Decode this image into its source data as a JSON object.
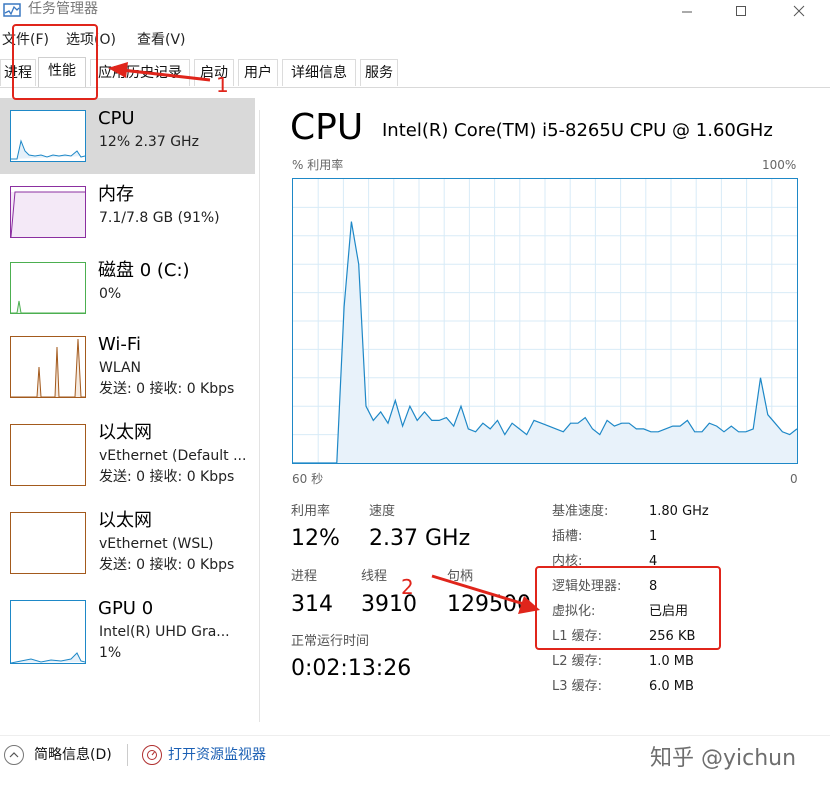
{
  "window": {
    "title": "任务管理器"
  },
  "menu": [
    "文件(F)",
    "选项(O)",
    "查看(V)"
  ],
  "tabs": [
    "进程",
    "性能",
    "应用历史记录",
    "启动",
    "用户",
    "详细信息",
    "服务"
  ],
  "sidebar": {
    "items": [
      {
        "title": "CPU",
        "line1": "12% 2.37 GHz",
        "line2": "",
        "color": "#1e88c7",
        "active": true
      },
      {
        "title": "内存",
        "line1": "7.1/7.8 GB (91%)",
        "line2": "",
        "color": "#8b2fa0",
        "active": false
      },
      {
        "title": "磁盘 0 (C:)",
        "line1": "0%",
        "line2": "",
        "color": "#4caf50",
        "active": false
      },
      {
        "title": "Wi-Fi",
        "line1": "WLAN",
        "line2": "发送: 0 接收: 0 Kbps",
        "color": "#a35a1d",
        "active": false
      },
      {
        "title": "以太网",
        "line1": "vEthernet (Default ...",
        "line2": "发送: 0 接收: 0 Kbps",
        "color": "#a35a1d",
        "active": false
      },
      {
        "title": "以太网",
        "line1": "vEthernet (WSL)",
        "line2": "发送: 0 接收: 0 Kbps",
        "color": "#a35a1d",
        "active": false
      },
      {
        "title": "GPU 0",
        "line1": "Intel(R) UHD Gra...",
        "line2": "1%",
        "color": "#1e88c7",
        "active": false
      }
    ]
  },
  "main": {
    "title": "CPU",
    "model": "Intel(R) Core(TM) i5-8265U CPU @ 1.60GHz",
    "graph": {
      "ylabel": "% 利用率",
      "ymax_label": "100%",
      "xleft_label": "60 秒",
      "xright_label": "0",
      "accent": "#1e88c7",
      "values": [
        0,
        0,
        0,
        0,
        0,
        0,
        0,
        55,
        85,
        70,
        20,
        15,
        18,
        14,
        22,
        13,
        20,
        15,
        18,
        15,
        15,
        16,
        13,
        20,
        12,
        11,
        14,
        12,
        15,
        10,
        14,
        12,
        10,
        15,
        14,
        13,
        12,
        11,
        14,
        14,
        16,
        12,
        10,
        15,
        13,
        14,
        14,
        12,
        12,
        11,
        11,
        12,
        13,
        13,
        15,
        11,
        11,
        14,
        13,
        11,
        13,
        11,
        11,
        12,
        30,
        17,
        14,
        11,
        10,
        12
      ]
    },
    "stats": {
      "util_label": "利用率",
      "util_value": "12%",
      "speed_label": "速度",
      "speed_value": "2.37 GHz",
      "proc_label": "进程",
      "proc_value": "314",
      "thread_label": "线程",
      "thread_value": "3910",
      "handle_label": "句柄",
      "handle_value": "129500",
      "uptime_label": "正常运行时间",
      "uptime_value": "0:02:13:26"
    },
    "specs": [
      {
        "label": "基准速度:",
        "value": "1.80 GHz"
      },
      {
        "label": "插槽:",
        "value": "1"
      },
      {
        "label": "内核:",
        "value": "4"
      },
      {
        "label": "逻辑处理器:",
        "value": "8"
      },
      {
        "label": "虚拟化:",
        "value": "已启用"
      },
      {
        "label": "L1 缓存:",
        "value": "256 KB"
      },
      {
        "label": "L2 缓存:",
        "value": "1.0 MB"
      },
      {
        "label": "L3 缓存:",
        "value": "6.0 MB"
      }
    ]
  },
  "bottom": {
    "brief": "简略信息(D)",
    "monitor": "打开资源监视器"
  },
  "watermark": "知乎 @yichun",
  "annotations": {
    "one": "1",
    "two": "2",
    "color": "#e0251b"
  }
}
